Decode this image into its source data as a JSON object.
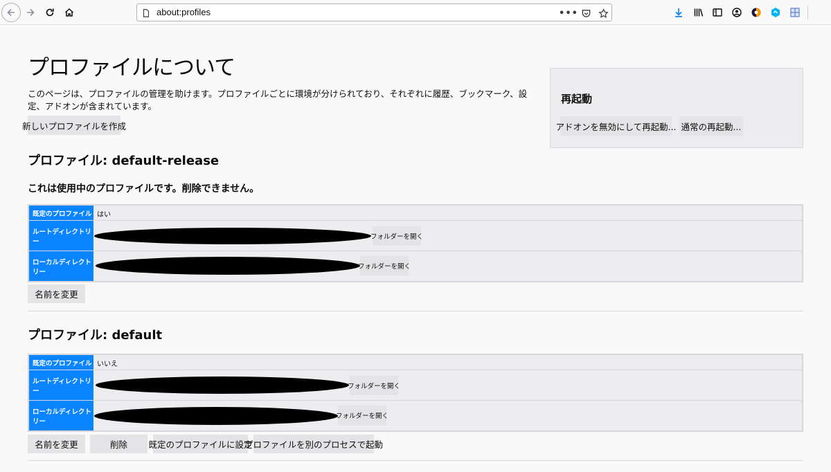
{
  "browser": {
    "url": "about:profiles"
  },
  "page": {
    "title": "プロファイルについて",
    "intro": "このページは、プロファイルの管理を助けます。プロファイルごとに環境が分けられており、それぞれに履歴、ブックマーク、設定、アドオンが含まれています。",
    "create_button": "新しいプロファイルを作成"
  },
  "restart": {
    "title": "再起動",
    "safe_mode_button": "アドオンを無効にして再起動...",
    "normal_button": "通常の再起動..."
  },
  "labels": {
    "default_profile": "既定のプロファイル",
    "root_dir": "ルートディレクトリー",
    "local_dir": "ローカルディレクトリー",
    "open_folder": "フォルダーを開く",
    "rename": "名前を変更",
    "delete": "削除",
    "set_default": "既定のプロファイルに設定",
    "launch": "プロファイルを別のプロセスで起動"
  },
  "profiles": [
    {
      "heading": "プロファイル: default-release",
      "in_use_message": "これは使用中のプロファイルです。削除できません。",
      "is_default": "はい"
    },
    {
      "heading": "プロファイル: default",
      "is_default": "いいえ"
    }
  ]
}
